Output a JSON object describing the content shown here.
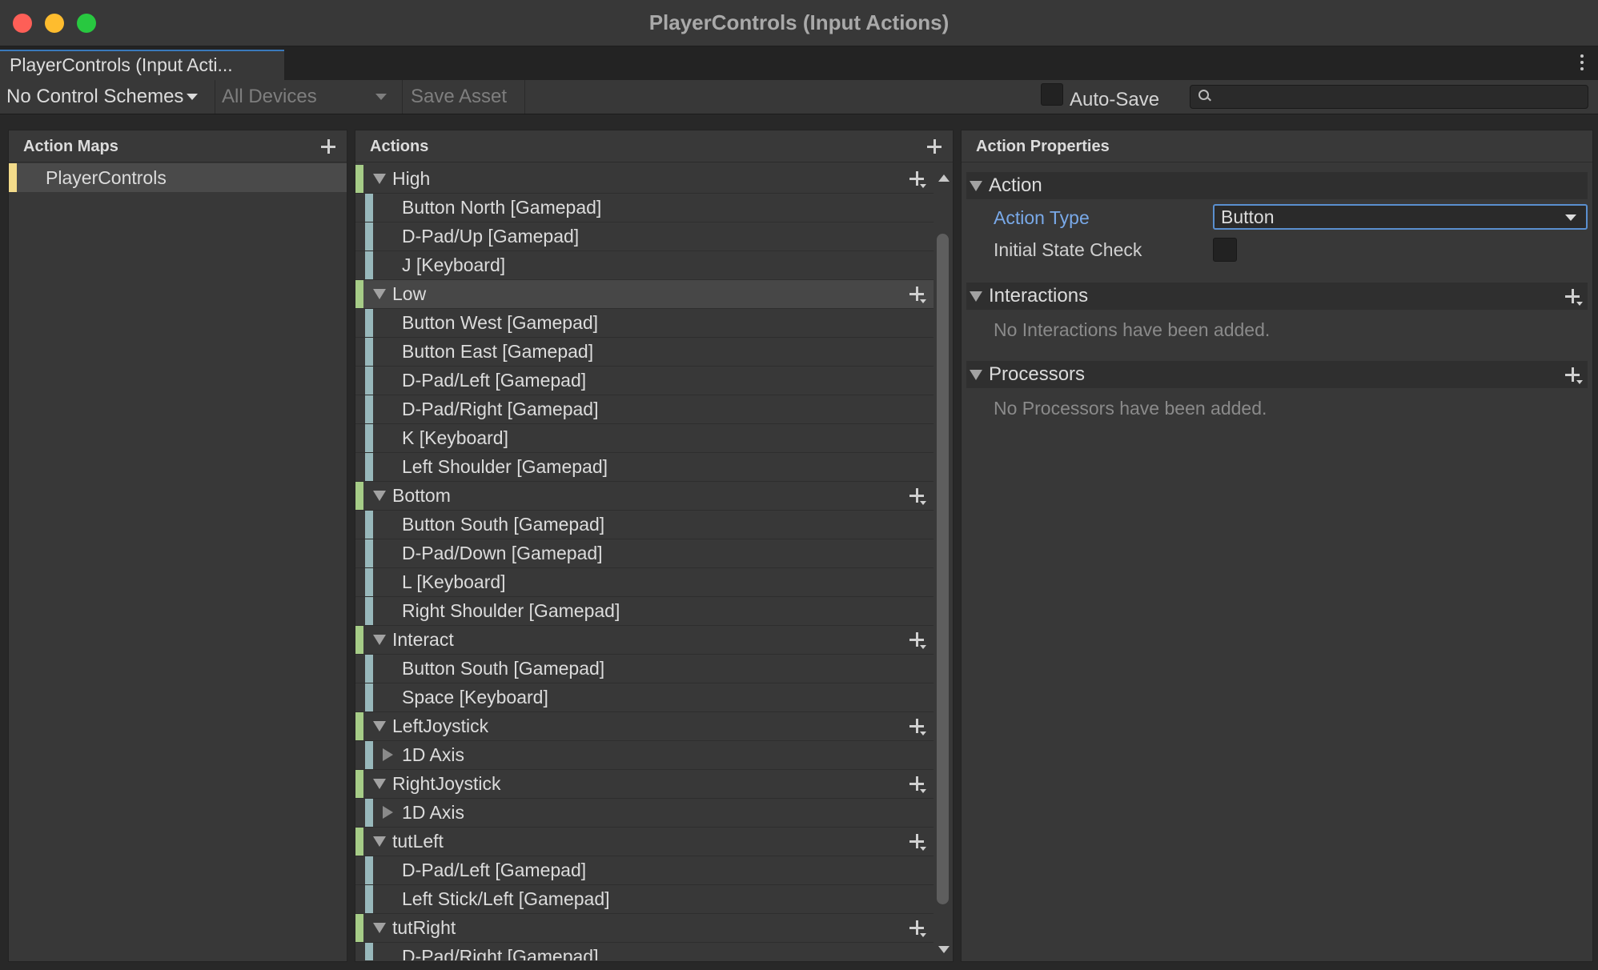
{
  "window": {
    "title": "PlayerControls (Input Actions)"
  },
  "tab": {
    "label": "PlayerControls (Input Acti..."
  },
  "toolbar": {
    "control_schemes": "No Control Schemes",
    "devices": "All Devices",
    "save_asset": "Save Asset",
    "auto_save": "Auto-Save",
    "search_placeholder": ""
  },
  "action_maps": {
    "header": "Action Maps",
    "items": [
      {
        "label": "PlayerControls",
        "color": "#f3db8a"
      }
    ]
  },
  "actions": {
    "header": "Actions",
    "rows": [
      {
        "kind": "action",
        "label": "High"
      },
      {
        "kind": "binding",
        "label": "Button North [Gamepad]"
      },
      {
        "kind": "binding",
        "label": "D-Pad/Up [Gamepad]"
      },
      {
        "kind": "binding",
        "label": "J [Keyboard]"
      },
      {
        "kind": "action",
        "label": "Low",
        "selected": true
      },
      {
        "kind": "binding",
        "label": "Button West [Gamepad]"
      },
      {
        "kind": "binding",
        "label": "Button East [Gamepad]"
      },
      {
        "kind": "binding",
        "label": "D-Pad/Left [Gamepad]"
      },
      {
        "kind": "binding",
        "label": "D-Pad/Right [Gamepad]"
      },
      {
        "kind": "binding",
        "label": "K [Keyboard]"
      },
      {
        "kind": "binding",
        "label": "Left Shoulder [Gamepad]"
      },
      {
        "kind": "action",
        "label": "Bottom"
      },
      {
        "kind": "binding",
        "label": "Button South [Gamepad]"
      },
      {
        "kind": "binding",
        "label": "D-Pad/Down [Gamepad]"
      },
      {
        "kind": "binding",
        "label": "L [Keyboard]"
      },
      {
        "kind": "binding",
        "label": "Right Shoulder [Gamepad]"
      },
      {
        "kind": "action",
        "label": "Interact"
      },
      {
        "kind": "binding",
        "label": "Button South [Gamepad]"
      },
      {
        "kind": "binding",
        "label": "Space [Keyboard]"
      },
      {
        "kind": "action",
        "label": "LeftJoystick"
      },
      {
        "kind": "composite",
        "label": "1D Axis"
      },
      {
        "kind": "action",
        "label": "RightJoystick"
      },
      {
        "kind": "composite",
        "label": "1D Axis"
      },
      {
        "kind": "action",
        "label": "tutLeft"
      },
      {
        "kind": "binding",
        "label": "D-Pad/Left [Gamepad]"
      },
      {
        "kind": "binding",
        "label": "Left Stick/Left [Gamepad]"
      },
      {
        "kind": "action",
        "label": "tutRight"
      },
      {
        "kind": "binding",
        "label": "D-Pad/Right [Gamepad]"
      }
    ]
  },
  "properties": {
    "header": "Action Properties",
    "action_section": "Action",
    "action_type_label": "Action Type",
    "action_type_value": "Button",
    "initial_state_label": "Initial State Check",
    "interactions_section": "Interactions",
    "interactions_empty": "No Interactions have been added.",
    "processors_section": "Processors",
    "processors_empty": "No Processors have been added."
  },
  "colors": {
    "accent": "#3a79bb",
    "action_stripe": "#a6cc87",
    "binding_stripe": "#98b8bb",
    "map_stripe": "#f3db8a",
    "label_highlight": "#79a9e8"
  },
  "icons": [
    "close-icon",
    "minimize-icon",
    "maximize-icon",
    "kebab-menu-icon",
    "dropdown-caret-icon",
    "search-icon",
    "plus-icon",
    "triangle-expanded-icon",
    "triangle-collapsed-icon",
    "scroll-up-icon",
    "scroll-down-icon"
  ]
}
